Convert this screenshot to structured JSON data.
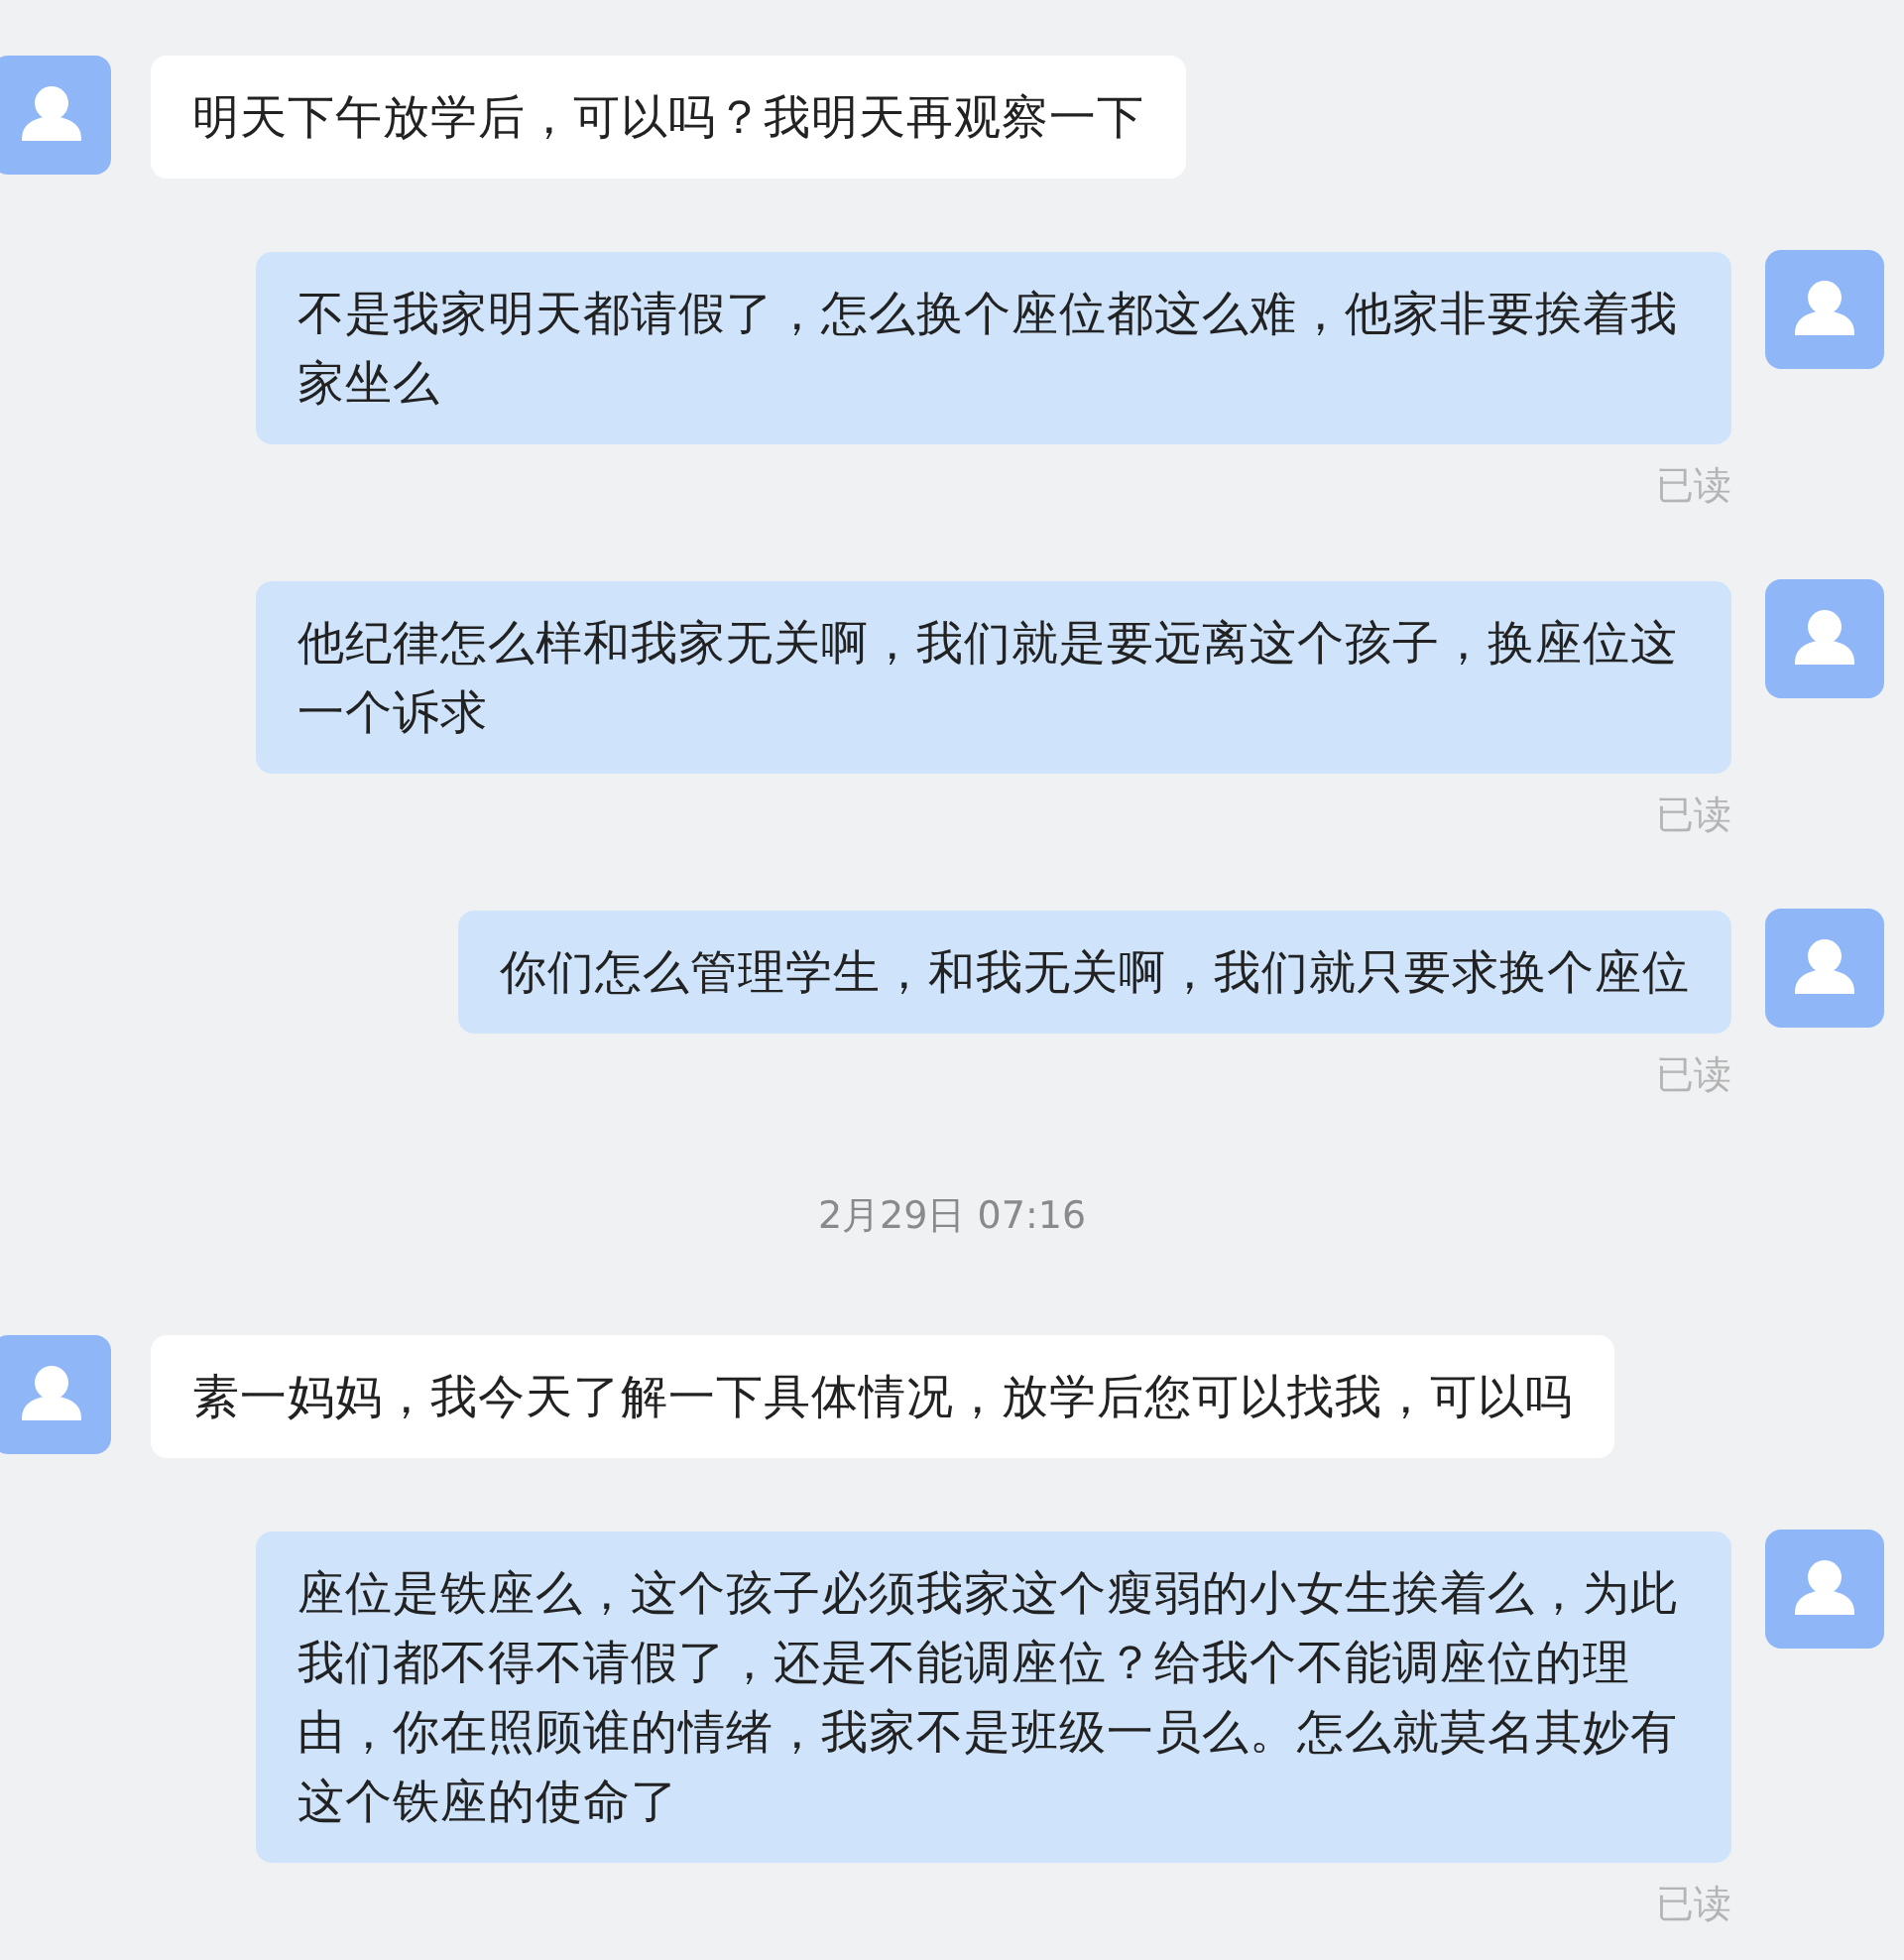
{
  "messages": [
    {
      "kind": "received",
      "text": "明天下午放学后，可以吗？我明天再观察一下"
    },
    {
      "kind": "sent",
      "text": "不是我家明天都请假了，怎么换个座位都这么难，他家非要挨着我家坐么",
      "status": "已读"
    },
    {
      "kind": "sent",
      "text": "他纪律怎么样和我家无关啊，我们就是要远离这个孩子，换座位这一个诉求",
      "status": "已读"
    },
    {
      "kind": "sent",
      "text": "你们怎么管理学生，和我无关啊，我们就只要求换个座位",
      "status": "已读"
    },
    {
      "kind": "time",
      "text": "2月29日 07:16"
    },
    {
      "kind": "received",
      "text": "素一妈妈，我今天了解一下具体情况，放学后您可以找我，可以吗"
    },
    {
      "kind": "sent",
      "text": "座位是铁座么，这个孩子必须我家这个瘦弱的小女生挨着么，为此我们都不得不请假了，还是不能调座位？给我个不能调座位的理由，你在照顾谁的情绪，我家不是班级一员么。怎么就莫名其妙有这个铁座的使命了",
      "status": "已读"
    }
  ]
}
